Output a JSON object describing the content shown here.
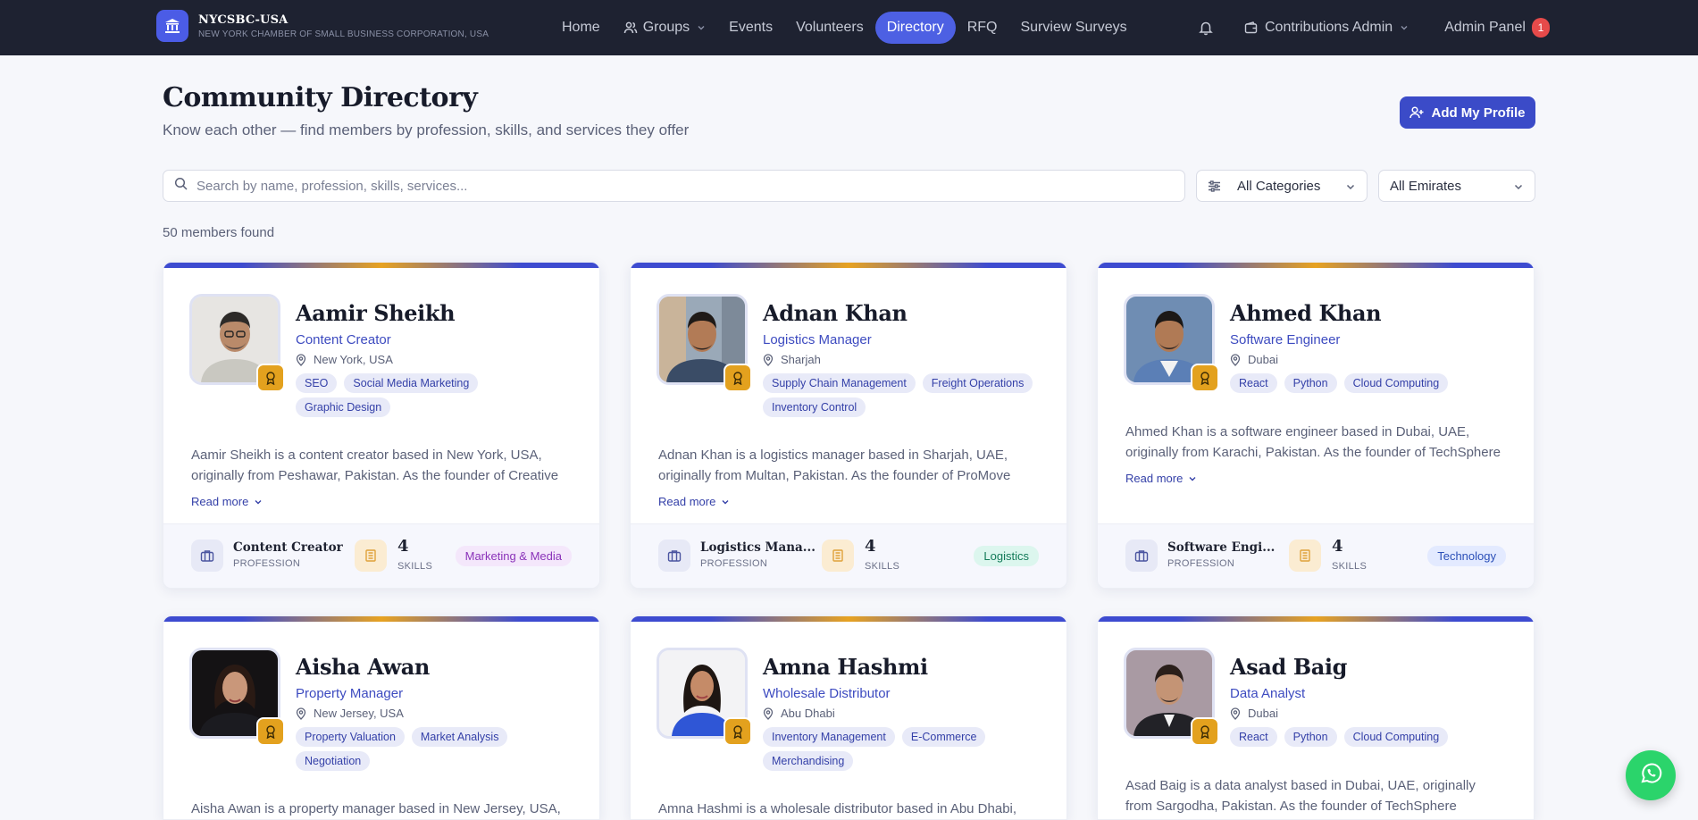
{
  "brand": {
    "name": "NYCSBC-USA",
    "subtitle": "NEW YORK CHAMBER OF SMALL BUSINESS CORPORATION, USA"
  },
  "nav": {
    "items": [
      {
        "label": "Home"
      },
      {
        "label": "Groups"
      },
      {
        "label": "Events"
      },
      {
        "label": "Volunteers"
      },
      {
        "label": "Directory"
      },
      {
        "label": "RFQ"
      },
      {
        "label": "Surview Surveys"
      }
    ],
    "active": "Directory",
    "contributions": "Contributions Admin",
    "admin": "Admin Panel",
    "admin_badge": "1"
  },
  "header": {
    "title": "Community Directory",
    "subtitle": "Know each other — find members by profession, skills, and services they offer",
    "add_button": "Add My Profile"
  },
  "filters": {
    "search_placeholder": "Search by name, profession, skills, services...",
    "category": "All Categories",
    "emirate": "All Emirates"
  },
  "results_count": "50 members found",
  "labels": {
    "profession": "PROFESSION",
    "skills": "SKILLS",
    "read_more": "Read more"
  },
  "members": [
    {
      "name": "Aamir Sheikh",
      "role": "Content Creator",
      "location": "New York, USA",
      "tags": [
        "SEO",
        "Social Media Marketing",
        "Graphic Design"
      ],
      "bio": "Aamir Sheikh is a content creator based in New York, USA, originally from Peshawar, Pakistan. As the founder of Creative",
      "profession": "Content Creator",
      "skills": "4",
      "category": "Marketing & Media"
    },
    {
      "name": "Adnan Khan",
      "role": "Logistics Manager",
      "location": "Sharjah",
      "tags": [
        "Supply Chain Management",
        "Freight Operations",
        "Inventory Control"
      ],
      "bio": "Adnan Khan is a logistics manager based in Sharjah, UAE, originally from Multan, Pakistan. As the founder of ProMove",
      "profession": "Logistics Mana...",
      "skills": "4",
      "category": "Logistics"
    },
    {
      "name": "Ahmed Khan",
      "role": "Software Engineer",
      "location": "Dubai",
      "tags": [
        "React",
        "Python",
        "Cloud Computing"
      ],
      "bio": "Ahmed Khan is a software engineer based in Dubai, UAE, originally from Karachi, Pakistan. As the founder of TechSphere",
      "profession": "Software Engi...",
      "skills": "4",
      "category": "Technology"
    },
    {
      "name": "Aisha Awan",
      "role": "Property Manager",
      "location": "New Jersey, USA",
      "tags": [
        "Property Valuation",
        "Market Analysis",
        "Negotiation"
      ],
      "bio": "Aisha Awan is a property manager based in New Jersey, USA,"
    },
    {
      "name": "Amna Hashmi",
      "role": "Wholesale Distributor",
      "location": "Abu Dhabi",
      "tags": [
        "Inventory Management",
        "E-Commerce",
        "Merchandising"
      ],
      "bio": "Amna Hashmi is a wholesale distributor based in Abu Dhabi, UAE,"
    },
    {
      "name": "Asad Baig",
      "role": "Data Analyst",
      "location": "Dubai",
      "tags": [
        "React",
        "Python",
        "Cloud Computing"
      ],
      "bio": "Asad Baig is a data analyst based in Dubai, UAE, originally from Sargodha, Pakistan. As the founder of TechSphere Solutions, he"
    }
  ]
}
